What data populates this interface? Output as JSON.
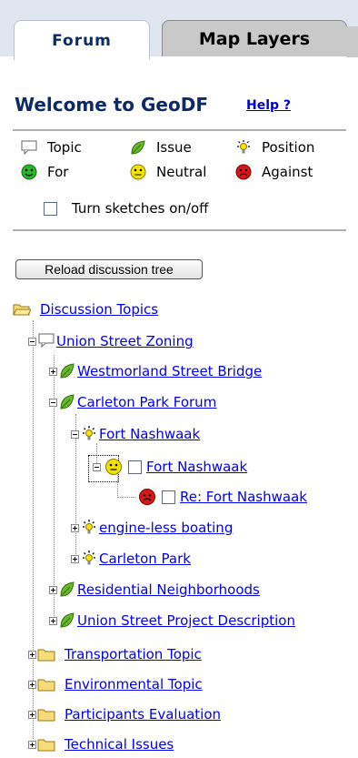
{
  "tabs": [
    {
      "label": "Forum",
      "active": true
    },
    {
      "label": "Map Layers",
      "active": false
    }
  ],
  "header": {
    "title": "Welcome to GeoDF",
    "help_link": "Help ?"
  },
  "legend": {
    "topic": "Topic",
    "issue": "Issue",
    "position": "Position",
    "for": "For",
    "neutral": "Neutral",
    "against": "Against",
    "sketches_toggle": "Turn sketches on/off"
  },
  "reload_button": "Reload discussion tree",
  "tree": {
    "root": "Discussion Topics",
    "topic_union": "Union Street Zoning",
    "issue_westmorland": "Westmorland Street Bridge",
    "issue_carleton_forum": "Carleton Park Forum",
    "position_fort": "Fort Nashwaak",
    "comment_fort": "Fort Nashwaak",
    "comment_re_fort": "Re: Fort Nashwaak",
    "position_engine": "engine-less boating",
    "position_carleton": "Carleton Park",
    "issue_residential": "Residential Neighborhoods",
    "issue_union_desc": "Union Street Project Description",
    "folder_transport": "Transportation Topic",
    "folder_env": "Environmental Topic",
    "folder_participants": "Participants Evaluation",
    "folder_technical": "Technical Issues"
  },
  "colors": {
    "link": "#0000ee",
    "title": "#0b2a68",
    "for": "#2bb52b",
    "neutral": "#f2e200",
    "against": "#d81818"
  }
}
